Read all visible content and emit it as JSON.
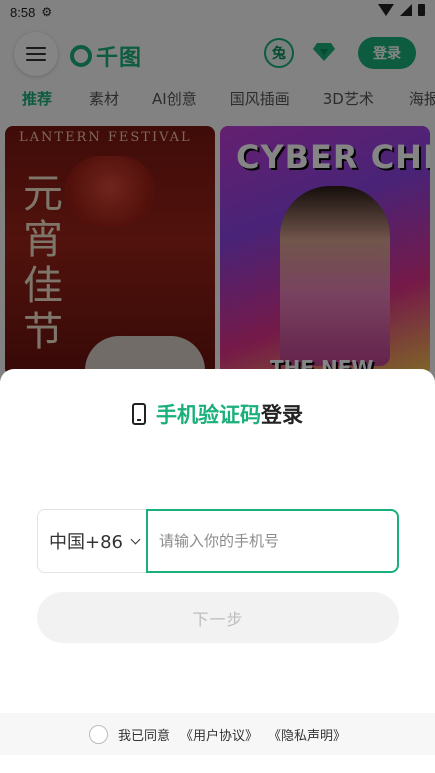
{
  "status_bar": {
    "time": "8:58",
    "icons": [
      "settings-icon",
      "wifi-icon",
      "signal-icon",
      "battery-icon"
    ]
  },
  "app_header": {
    "logo_text": "千图",
    "rabbit_badge": "兔",
    "login_label": "登录",
    "brand_color": "#19b07a"
  },
  "tabs": [
    {
      "label": "推荐",
      "active": true
    },
    {
      "label": "素材",
      "active": false
    },
    {
      "label": "AI创意",
      "active": false
    },
    {
      "label": "国风插画",
      "active": false
    },
    {
      "label": "3D艺术",
      "active": false
    },
    {
      "label": "海报设",
      "active": false
    }
  ],
  "cards": {
    "card1": {
      "en": "LANTERN FESTIVAL",
      "cn": "元宵佳节"
    },
    "card2": {
      "title": "CYBER CHIC",
      "footer": "THE NEW"
    }
  },
  "login_sheet": {
    "title_highlight": "手机验证码",
    "title_rest": "登录",
    "country_code": "中国+86",
    "phone_placeholder": "请输入你的手机号",
    "phone_value": "",
    "next_label": "下一步",
    "agree_text": "我已同意",
    "user_agreement": "《用户协议》",
    "privacy_statement": "《隐私声明》"
  }
}
